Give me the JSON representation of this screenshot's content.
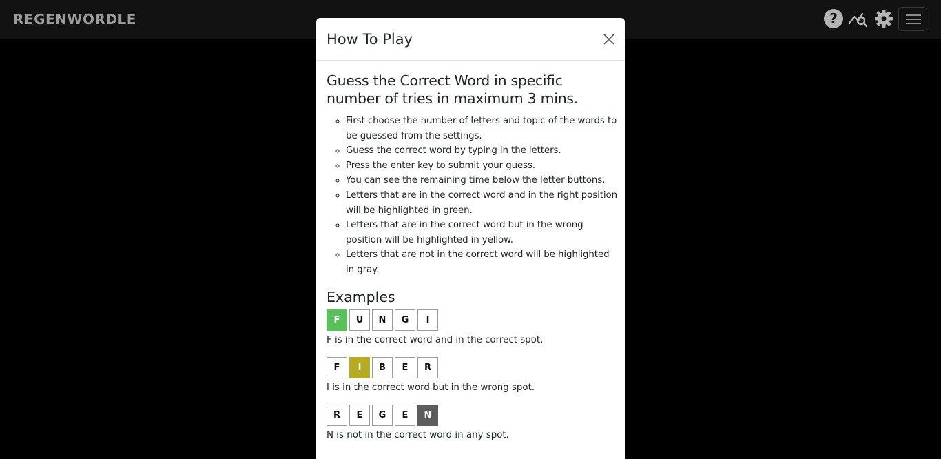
{
  "app": {
    "logo_text": "REGENWORDLE"
  },
  "topbar": {
    "icons": [
      "help-icon",
      "stats-icon",
      "gear-icon",
      "menu-icon"
    ],
    "help_glyph": "?"
  },
  "modal": {
    "title": "How To Play",
    "heading": "Guess the Correct Word in specific number of tries in maximum 3 mins.",
    "rules": [
      "First choose the number of letters and topic of the words to be guessed from the settings.",
      "Guess the correct word by typing in the letters.",
      "Press the enter key to submit your guess.",
      "You can see the remaining time below the letter buttons.",
      "Letters that are in the correct word and in the right position will be highlighted in green.",
      "Letters that are in the correct word but in the wrong position will be highlighted in yellow.",
      "Letters that are not in the correct word will be highlighted in gray."
    ],
    "examples_title": "Examples",
    "examples": [
      {
        "letters": [
          "F",
          "U",
          "N",
          "G",
          "I"
        ],
        "highlight_index": 0,
        "highlight": "green",
        "caption": "F is in the correct word and in the correct spot."
      },
      {
        "letters": [
          "F",
          "I",
          "B",
          "E",
          "R"
        ],
        "highlight_index": 1,
        "highlight": "yellow",
        "caption": "I is in the correct word but in the wrong spot."
      },
      {
        "letters": [
          "R",
          "E",
          "G",
          "E",
          "N"
        ],
        "highlight_index": 4,
        "highlight": "gray",
        "caption": "N is not in the correct word in any spot."
      }
    ]
  },
  "colors": {
    "green": "#58c15a",
    "yellow": "#b5ac24",
    "gray": "#5d5d5d",
    "topbar": "#121212"
  }
}
